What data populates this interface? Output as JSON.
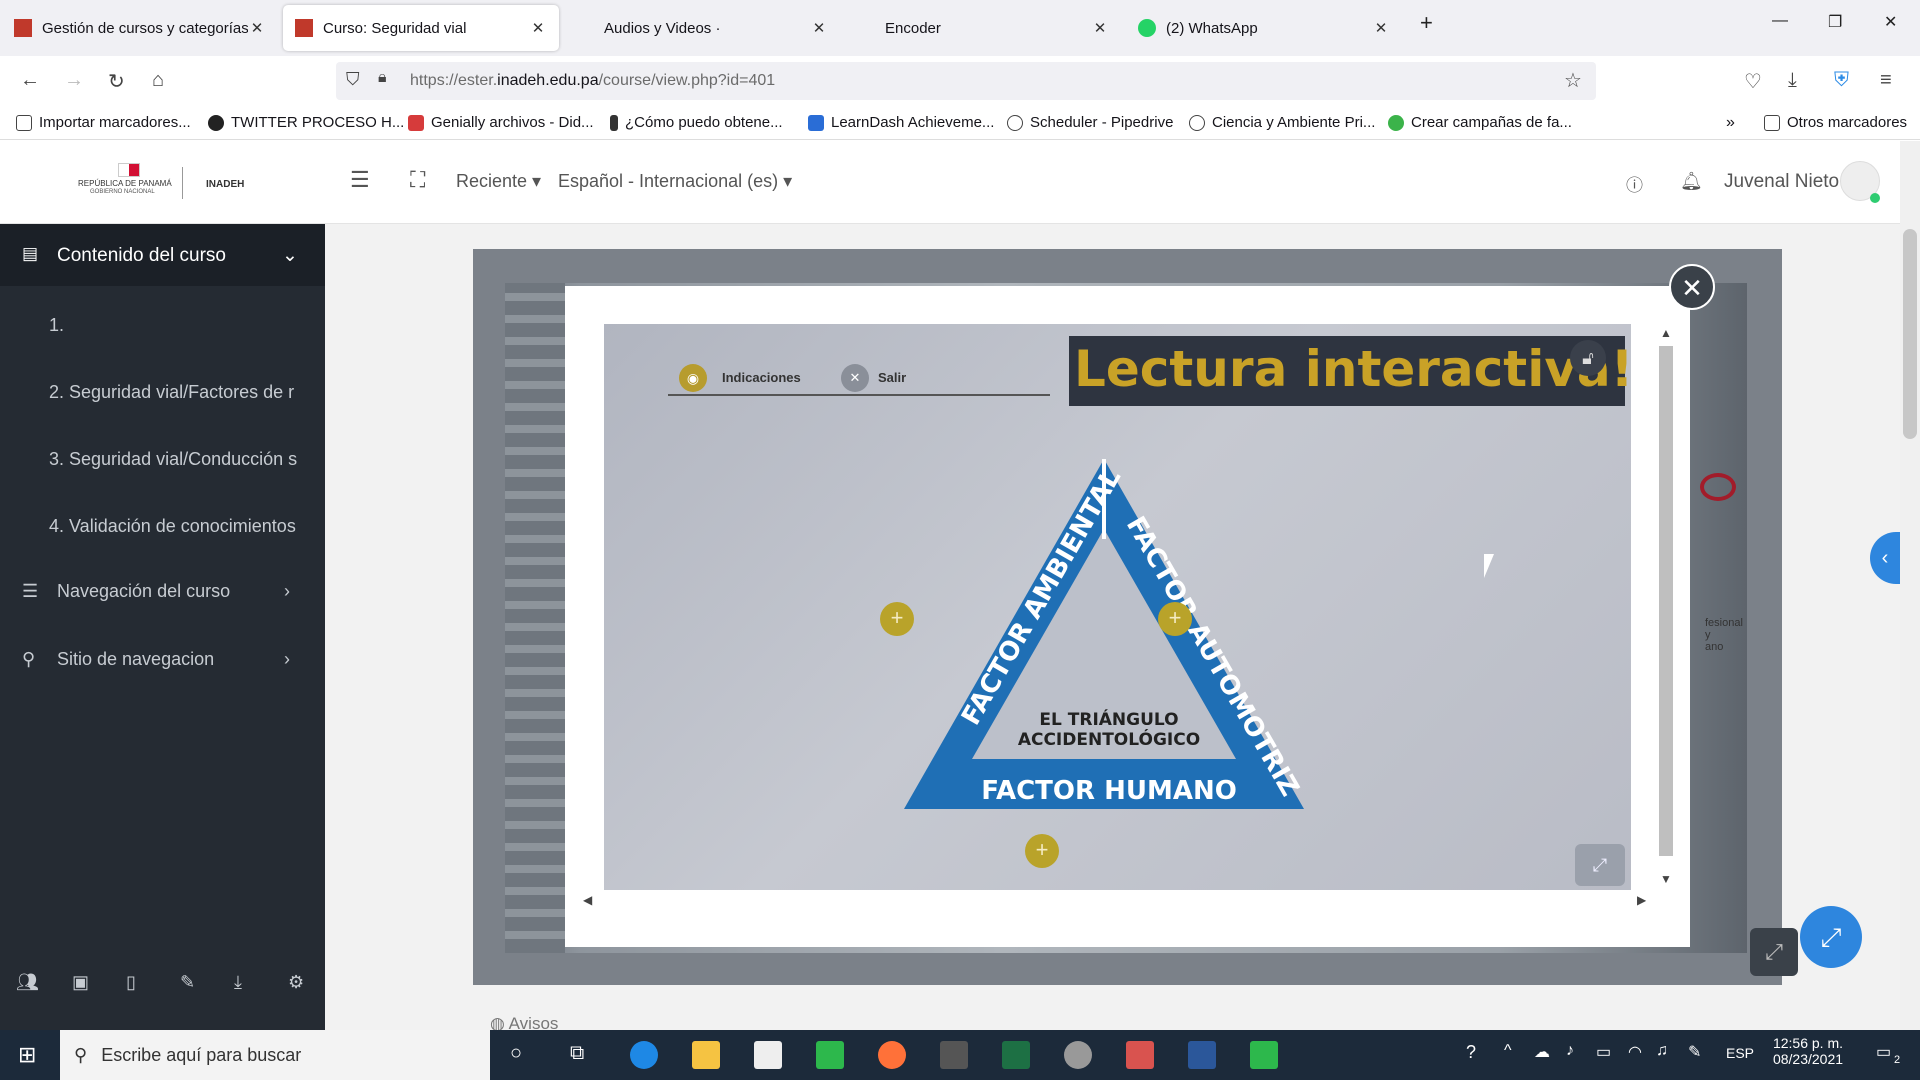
{
  "browser": {
    "tabs": [
      {
        "title": "Gestión de cursos y categorías",
        "favicon_color": "#c0392b",
        "active": false
      },
      {
        "title": "Curso: Seguridad vial",
        "favicon_color": "#c0392b",
        "active": true
      },
      {
        "title": "Audios y Videos ·",
        "favicon_color": "",
        "active": false
      },
      {
        "title": "Encoder",
        "favicon_color": "",
        "active": false
      },
      {
        "title": "(2) WhatsApp",
        "favicon_color": "#25d366",
        "active": false
      }
    ],
    "url_prefix": "https://ester.",
    "url_domain": "inadeh.edu.pa",
    "url_path": "/course/view.php?id=401",
    "bookmarks": [
      "Importar marcadores...",
      "TWITTER PROCESO H...",
      "Genially archivos - Did...",
      "¿Cómo puedo obtene...",
      "LearnDash Achieveme...",
      "Scheduler - Pipedrive",
      "Ciencia y Ambiente Pri...",
      "Crear campañas de fa...",
      "Otros marcadores"
    ]
  },
  "header": {
    "logo_text": "REPÚBLICA DE PANAMÁ",
    "logo_sub": "GOBIERNO NACIONAL",
    "logo_brand": "INADEH",
    "recent": "Reciente",
    "language": "Español - Internacional (es)",
    "user_name": "Juvenal Nieto"
  },
  "sidebar": {
    "title": "Contenido del curso",
    "items": [
      "1.",
      "2. Seguridad vial/Factores de r",
      "3. Seguridad vial/Conducción s",
      "4. Validación de conocimientos"
    ],
    "sections": [
      "Navegación del curso",
      "Sitio de navegacion"
    ]
  },
  "interactive": {
    "btn_indicaciones": "Indicaciones",
    "btn_salir": "Salir",
    "banner": "Lectura interactiva!",
    "triangle_left": "FACTOR AMBIENTAL",
    "triangle_right": "FACTOR AUTOMOTRIZ",
    "triangle_bottom": "FACTOR HUMANO",
    "triangle_center_1": "EL TRIÁNGULO",
    "triangle_center_2": "ACCIDENTOLÓGICO",
    "side_text_1": "fesional y",
    "side_text_2": "ano"
  },
  "footer_peek": "Avisos",
  "taskbar": {
    "search_placeholder": "Escribe aquí para buscar",
    "lang": "ESP",
    "time": "12:56 p. m.",
    "date": "08/23/2021",
    "notifications": "2"
  },
  "colors": {
    "sidebar_bg": "#252b33",
    "banner_text": "#c9a227",
    "triangle_blue": "#1f6fb5",
    "plus_gold": "#b9a32a"
  }
}
